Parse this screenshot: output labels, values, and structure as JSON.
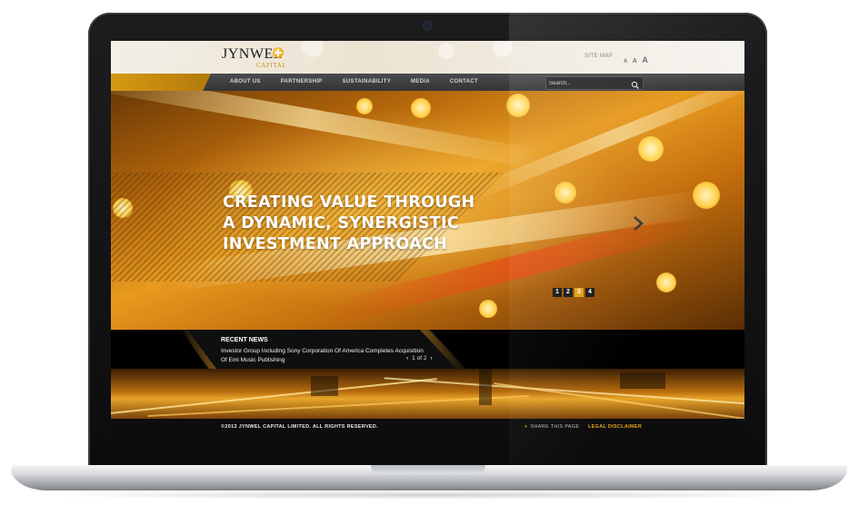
{
  "header": {
    "logo_text": "JYNWEL",
    "logo_subtext": "CAPITAL",
    "site_map_label": "SITE MAP",
    "font_size_controls": [
      "A",
      "A",
      "A"
    ]
  },
  "nav": {
    "items": [
      {
        "label": "ABOUT US"
      },
      {
        "label": "PARTNERSHIP"
      },
      {
        "label": "SUSTAINABILITY"
      },
      {
        "label": "MEDIA"
      },
      {
        "label": "CONTACT"
      }
    ],
    "search_placeholder": "Search..."
  },
  "hero": {
    "headline_lines": [
      "CREATING VALUE THROUGH",
      "A DYNAMIC, SYNERGISTIC",
      "INVESTMENT APPROACH"
    ],
    "slides": [
      "1",
      "2",
      "3",
      "4"
    ],
    "active_slide": "3"
  },
  "news": {
    "heading": "RECENT NEWS",
    "items": [
      "Investor Group Including Sony Corporation Of America Completes Acquisition Of Emi Music Publishing"
    ],
    "pager_text": "1 of 2"
  },
  "footer": {
    "copyright": "©2013 JYNWEL CAPITAL LIMITED. ALL RIGHTS RESERVED.",
    "share_label": "SHARE THIS PAGE",
    "legal_label": "LEGAL DISCLAIMER"
  },
  "colors": {
    "accent": "#e2a21c",
    "nav_bg": "#3f3f42",
    "header_bg": "#efe8da",
    "footer_bg": "#0d0d0e"
  },
  "icons": [
    "search-icon",
    "chevron-right-icon",
    "chevron-left-icon",
    "plus-icon",
    "camera-icon"
  ]
}
